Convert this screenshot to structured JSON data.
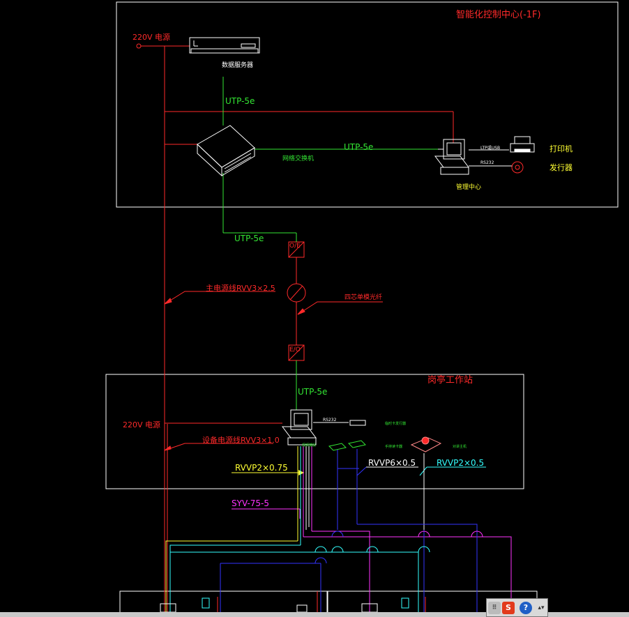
{
  "title": "智能化控制中心(-1F)",
  "labels": {
    "power_top": "220V 电源",
    "server": "数据服务器",
    "utp_server": "UTP-5e",
    "utp_switch_mgmt": "UTP-5e",
    "switch": "网络交换机",
    "printer_port": "LTP或USB",
    "rs232_top": "RS232",
    "printer": "打印机",
    "issuer": "发行器",
    "mgmt_center": "管理中心",
    "utp_down": "UTP-5e",
    "main_power_cable": "主电源线RVV3×2.5",
    "fiber": "四芯单模光纤",
    "oe_top": "O/E",
    "eo_bottom": "E/O",
    "guard_station": "岗亭工作站",
    "utp_station": "UTP-5e",
    "power_station": "220V 电源",
    "device_power_cable": "设备电源线RVV3×1.0",
    "rs232_station": "RS232",
    "card_dispenser": "临时卡发行器",
    "video_capture": "视频捕捉",
    "handheld_reader": "手持读卡器",
    "intercom": "对讲主机",
    "rvvp2_075": "RVVP2×0.75",
    "rvvp6_05": "RVVP6×0.5",
    "rvvp2_05": "RVVP2×0.5",
    "syv": "SYV-75-5"
  },
  "colors": {
    "power": "#ff2a2a",
    "network": "#33e633",
    "yellow": "#ffff33",
    "cyan": "#33ffff",
    "magenta": "#ff33ff",
    "blue": "#3333ff",
    "frame": "#ffffff"
  },
  "tray": {
    "icons": [
      "grid-icon",
      "sogou-icon",
      "help-icon",
      "pin-icon"
    ],
    "sogou_letter": "S",
    "help_letter": "?"
  }
}
